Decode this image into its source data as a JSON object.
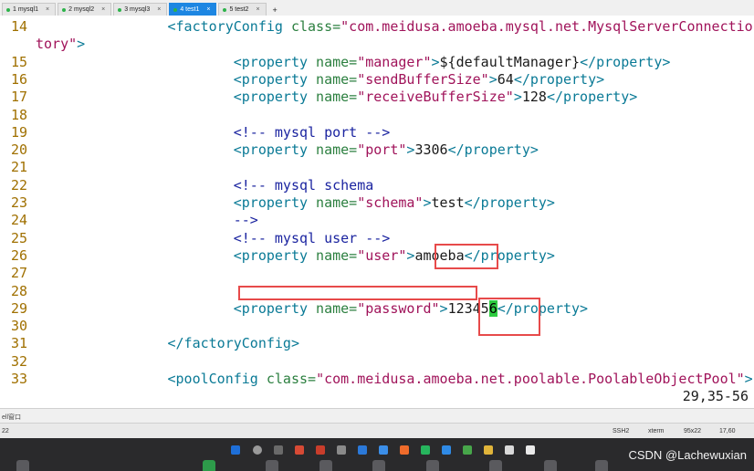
{
  "tabs": [
    {
      "label": "1 mysql1",
      "active": false
    },
    {
      "label": "2 mysql2",
      "active": false
    },
    {
      "label": "3 mysql3",
      "active": false
    },
    {
      "label": "4 test1",
      "active": true
    },
    {
      "label": "5 test2",
      "active": false
    }
  ],
  "tab_close_glyph": "×",
  "tab_add_glyph": "+",
  "editor": {
    "lines": [
      {
        "n": "14",
        "s": [
          [
            "                ",
            "t"
          ],
          [
            "<factoryConfig",
            "tag"
          ],
          [
            " class=",
            "attr"
          ],
          [
            "\"com.meidusa.amoeba.mysql.net.MysqlServerConnectionFac",
            "str"
          ]
        ]
      },
      {
        "n": "",
        "s": [
          [
            "tory\"",
            "str"
          ],
          [
            ">",
            "tag"
          ]
        ]
      },
      {
        "n": "15",
        "s": [
          [
            "                        ",
            "t"
          ],
          [
            "<property",
            "tag"
          ],
          [
            " name=",
            "attr"
          ],
          [
            "\"manager\"",
            "str"
          ],
          [
            ">",
            "tag"
          ],
          [
            "${defaultManager}",
            "t"
          ],
          [
            "</property>",
            "tag"
          ]
        ]
      },
      {
        "n": "16",
        "s": [
          [
            "                        ",
            "t"
          ],
          [
            "<property",
            "tag"
          ],
          [
            " name=",
            "attr"
          ],
          [
            "\"sendBufferSize\"",
            "str"
          ],
          [
            ">",
            "tag"
          ],
          [
            "64",
            "t"
          ],
          [
            "</property>",
            "tag"
          ]
        ]
      },
      {
        "n": "17",
        "s": [
          [
            "                        ",
            "t"
          ],
          [
            "<property",
            "tag"
          ],
          [
            " name=",
            "attr"
          ],
          [
            "\"receiveBufferSize\"",
            "str"
          ],
          [
            ">",
            "tag"
          ],
          [
            "128",
            "t"
          ],
          [
            "</property>",
            "tag"
          ]
        ]
      },
      {
        "n": "18",
        "s": []
      },
      {
        "n": "19",
        "s": [
          [
            "                        ",
            "t"
          ],
          [
            "<!-- mysql port -->",
            "cmt"
          ]
        ]
      },
      {
        "n": "20",
        "s": [
          [
            "                        ",
            "t"
          ],
          [
            "<property",
            "tag"
          ],
          [
            " name=",
            "attr"
          ],
          [
            "\"port\"",
            "str"
          ],
          [
            ">",
            "tag"
          ],
          [
            "3306",
            "t"
          ],
          [
            "</property>",
            "tag"
          ]
        ]
      },
      {
        "n": "21",
        "s": []
      },
      {
        "n": "22",
        "s": [
          [
            "                        ",
            "t"
          ],
          [
            "<!-- mysql schema",
            "cmt"
          ]
        ]
      },
      {
        "n": "23",
        "s": [
          [
            "                        ",
            "t"
          ],
          [
            "<property",
            "tag"
          ],
          [
            " name=",
            "attr"
          ],
          [
            "\"schema\"",
            "str"
          ],
          [
            ">",
            "tag"
          ],
          [
            "test",
            "t"
          ],
          [
            "</property>",
            "tag"
          ]
        ]
      },
      {
        "n": "24",
        "s": [
          [
            "                        ",
            "t"
          ],
          [
            "-->",
            "cmt"
          ]
        ]
      },
      {
        "n": "25",
        "s": [
          [
            "                        ",
            "t"
          ],
          [
            "<!-- mysql user -->",
            "cmt"
          ]
        ]
      },
      {
        "n": "26",
        "s": [
          [
            "                        ",
            "t"
          ],
          [
            "<property",
            "tag"
          ],
          [
            " name=",
            "attr"
          ],
          [
            "\"user\"",
            "str"
          ],
          [
            ">",
            "tag"
          ],
          [
            "amoeba",
            "t"
          ],
          [
            "</property>",
            "tag"
          ]
        ]
      },
      {
        "n": "27",
        "s": []
      },
      {
        "n": "28",
        "s": []
      },
      {
        "n": "29",
        "s": [
          [
            "                        ",
            "t"
          ],
          [
            "<property",
            "tag"
          ],
          [
            " name=",
            "attr"
          ],
          [
            "\"password\"",
            "str"
          ],
          [
            ">",
            "tag"
          ],
          [
            "12345",
            "t"
          ],
          [
            "6",
            "cur"
          ],
          [
            "</property>",
            "tag"
          ]
        ]
      },
      {
        "n": "30",
        "s": []
      },
      {
        "n": "31",
        "s": [
          [
            "                ",
            "t"
          ],
          [
            "</factoryConfig>",
            "tag"
          ]
        ]
      },
      {
        "n": "32",
        "s": []
      },
      {
        "n": "33",
        "s": [
          [
            "                ",
            "t"
          ],
          [
            "<poolConfig",
            "tag"
          ],
          [
            " class=",
            "attr"
          ],
          [
            "\"com.meidusa.amoeba.net.poolable.PoolableObjectPool\"",
            "str"
          ],
          [
            ">",
            "tag"
          ]
        ]
      }
    ],
    "cursor_position": "29,35-56"
  },
  "bar1": {
    "left_text": "ell窗口"
  },
  "bar2": {
    "left_text": "22",
    "protocol": "SSH2",
    "term": "xterm",
    "size": "95x22",
    "pos": "17,60"
  },
  "watermark": "CSDN @Lachewuxian",
  "colors": {
    "tab_active": "#1d86e2",
    "annotation": "#e74a4a",
    "cursor": "#2ecc40",
    "taskbar": "#2a2a2c"
  }
}
